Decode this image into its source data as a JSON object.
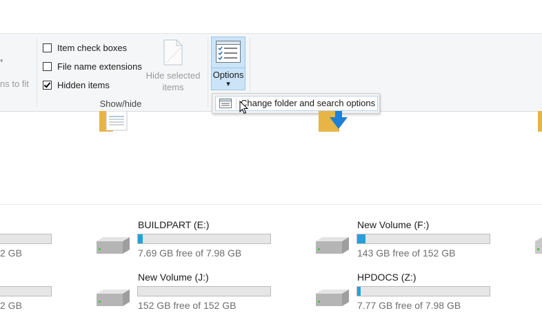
{
  "ribbon": {
    "partial_left_label": "ns to fit",
    "checkboxes": [
      {
        "label": "Item check boxes",
        "checked": false
      },
      {
        "label": "File name extensions",
        "checked": false
      },
      {
        "label": "Hidden items",
        "checked": true
      }
    ],
    "hide_selected_line1": "Hide selected",
    "hide_selected_line2": "items",
    "group_label": "Show/hide",
    "options_label": "Options",
    "options_arrow": "▾"
  },
  "dropdown": {
    "item_label": "Change folder and search options"
  },
  "drives": {
    "partial_left_1": "2 GB",
    "partial_left_2": "2 GB",
    "items": [
      {
        "name": "BUILDPART (E:)",
        "free": "7.69 GB free of 7.98 GB",
        "used_fraction": 0.036
      },
      {
        "name": "New Volume (F:)",
        "free": "143 GB free of 152 GB",
        "used_fraction": 0.06
      },
      {
        "name": "New Volume (J:)",
        "free": "152 GB free of 152 GB",
        "used_fraction": 0.0
      },
      {
        "name": "HPDOCS (Z:)",
        "free": "7.77 GB free of 7.98 GB",
        "used_fraction": 0.027
      }
    ]
  },
  "colors": {
    "accent": "#26a0da",
    "ribbon_bg": "#f5f6f7",
    "selected_button_bg": "#cce4f7"
  }
}
